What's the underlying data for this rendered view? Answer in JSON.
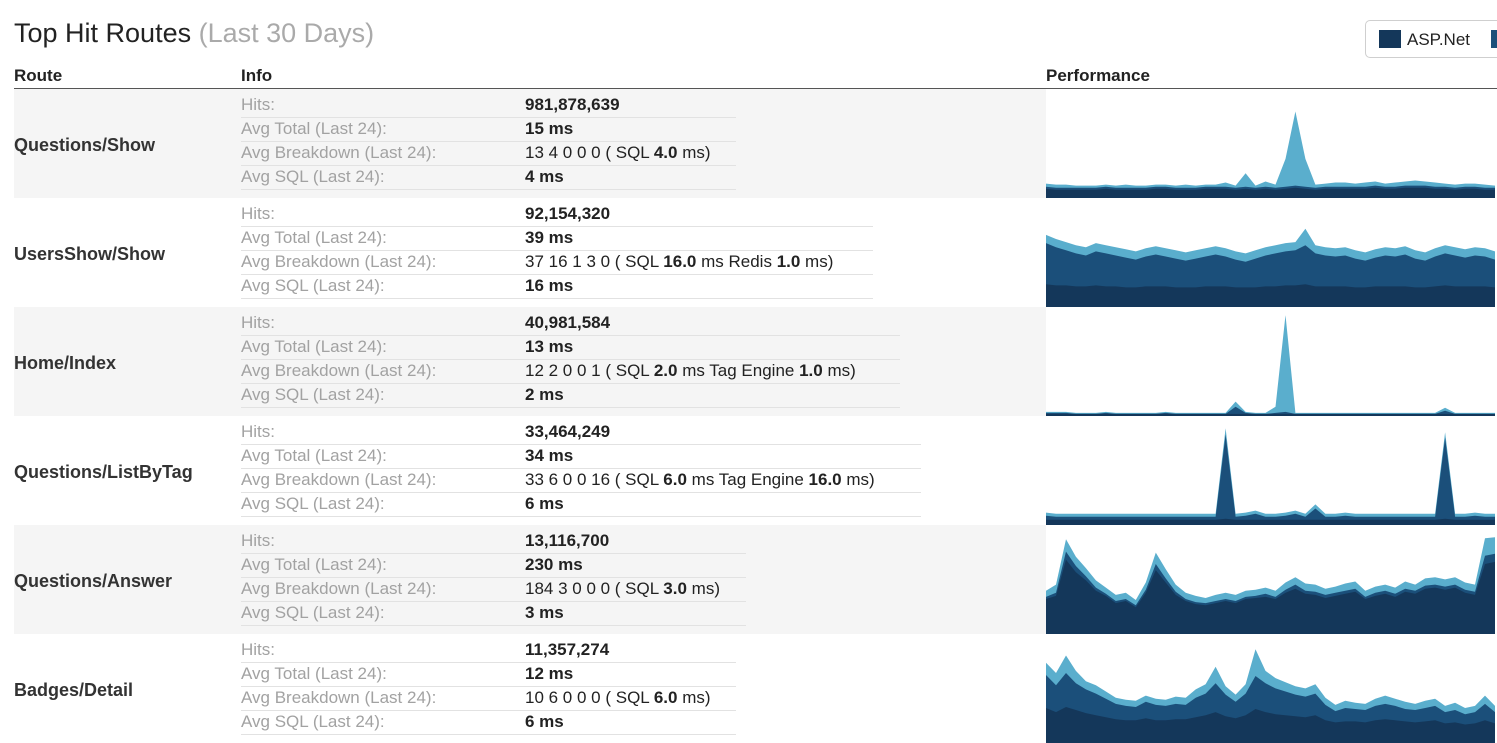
{
  "header": {
    "title": "Top Hit Routes",
    "subtitle": "(Last 30 Days)",
    "legend": "ASP.Net"
  },
  "columns": {
    "route": "Route",
    "info": "Info",
    "performance": "Performance"
  },
  "labels": {
    "hits": "Hits:",
    "avg_total": "Avg Total (Last 24):",
    "avg_breakdown": "Avg Breakdown (Last 24):",
    "avg_sql": "Avg SQL (Last 24):"
  },
  "colors": {
    "dark": "#14375a",
    "mid": "#1b4f7a",
    "light": "#5aaecd"
  },
  "rows": [
    {
      "route": "Questions/Show",
      "hits": "981,878,639",
      "avg_total": "15 ms",
      "breakdown": [
        {
          "t": "13 4 0 0 0 ( SQL "
        },
        {
          "t": "4.0",
          "b": true
        },
        {
          "t": " ms)"
        }
      ],
      "avg_sql": "4 ms",
      "perf": {
        "total": [
          14,
          13,
          13,
          12,
          12,
          12,
          13,
          12,
          13,
          12,
          12,
          13,
          13,
          12,
          13,
          12,
          13,
          13,
          15,
          12,
          24,
          12,
          16,
          13,
          38,
          84,
          38,
          13,
          14,
          15,
          15,
          14,
          15,
          16,
          14,
          15,
          16,
          17,
          16,
          15,
          14,
          13,
          14,
          14,
          13,
          12
        ],
        "mid": [
          11,
          10,
          10,
          10,
          10,
          10,
          11,
          10,
          10,
          10,
          10,
          11,
          11,
          10,
          10,
          10,
          11,
          11,
          11,
          10,
          11,
          10,
          11,
          10,
          11,
          12,
          11,
          10,
          11,
          11,
          11,
          11,
          11,
          12,
          11,
          11,
          12,
          12,
          12,
          11,
          11,
          10,
          11,
          11,
          10,
          10
        ],
        "dark": [
          9,
          8,
          8,
          8,
          8,
          8,
          9,
          8,
          8,
          8,
          8,
          9,
          9,
          8,
          8,
          8,
          9,
          9,
          9,
          8,
          9,
          8,
          9,
          8,
          9,
          10,
          9,
          8,
          9,
          9,
          9,
          9,
          9,
          10,
          9,
          9,
          10,
          10,
          10,
          9,
          9,
          8,
          9,
          9,
          8,
          8
        ]
      }
    },
    {
      "route": "UsersShow/Show",
      "hits": "92,154,320",
      "avg_total": "39 ms",
      "breakdown": [
        {
          "t": "37 16 1 3 0 ( SQL "
        },
        {
          "t": "16.0",
          "b": true
        },
        {
          "t": " ms Redis "
        },
        {
          "t": "1.0",
          "b": true
        },
        {
          "t": " ms)"
        }
      ],
      "avg_sql": "16 ms",
      "perf": {
        "total": [
          70,
          66,
          63,
          60,
          58,
          62,
          60,
          58,
          56,
          54,
          57,
          59,
          57,
          55,
          53,
          55,
          57,
          59,
          57,
          54,
          52,
          55,
          58,
          60,
          62,
          63,
          76,
          60,
          58,
          57,
          58,
          55,
          53,
          56,
          58,
          57,
          59,
          55,
          53,
          57,
          60,
          58,
          56,
          58,
          57,
          54
        ],
        "mid": [
          62,
          58,
          55,
          52,
          50,
          54,
          52,
          50,
          48,
          46,
          49,
          51,
          49,
          47,
          45,
          47,
          49,
          51,
          49,
          46,
          44,
          47,
          50,
          52,
          54,
          55,
          60,
          52,
          50,
          49,
          50,
          47,
          45,
          48,
          50,
          49,
          51,
          47,
          45,
          49,
          52,
          50,
          48,
          50,
          49,
          46
        ],
        "dark": [
          22,
          21,
          21,
          20,
          20,
          21,
          20,
          20,
          19,
          19,
          20,
          20,
          20,
          19,
          19,
          19,
          20,
          20,
          20,
          19,
          19,
          19,
          20,
          20,
          21,
          21,
          22,
          20,
          20,
          20,
          20,
          19,
          19,
          20,
          20,
          20,
          20,
          19,
          19,
          20,
          21,
          20,
          20,
          20,
          20,
          19
        ]
      }
    },
    {
      "route": "Home/Index",
      "hits": "40,981,584",
      "avg_total": "13 ms",
      "breakdown": [
        {
          "t": "12 2 0 0 1 ( SQL "
        },
        {
          "t": "2.0",
          "b": true
        },
        {
          "t": " ms Tag Engine "
        },
        {
          "t": "1.0",
          "b": true
        },
        {
          "t": " ms)"
        }
      ],
      "avg_sql": "2 ms",
      "perf": {
        "total": [
          4,
          4,
          4,
          3,
          3,
          3,
          4,
          3,
          3,
          3,
          3,
          3,
          4,
          3,
          3,
          3,
          3,
          3,
          3,
          14,
          4,
          3,
          3,
          9,
          98,
          3,
          3,
          3,
          3,
          3,
          3,
          3,
          3,
          3,
          3,
          3,
          3,
          3,
          3,
          3,
          8,
          3,
          3,
          3,
          3,
          3
        ],
        "mid": [
          3,
          3,
          3,
          2,
          2,
          2,
          3,
          2,
          2,
          2,
          2,
          2,
          3,
          2,
          2,
          2,
          2,
          2,
          2,
          9,
          3,
          2,
          2,
          3,
          4,
          2,
          2,
          2,
          2,
          2,
          2,
          2,
          2,
          2,
          2,
          2,
          2,
          2,
          2,
          2,
          5,
          2,
          2,
          2,
          2,
          2
        ],
        "dark": [
          2,
          2,
          2,
          2,
          2,
          2,
          2,
          2,
          2,
          2,
          2,
          2,
          2,
          2,
          2,
          2,
          2,
          2,
          2,
          2,
          2,
          2,
          2,
          2,
          2,
          2,
          2,
          2,
          2,
          2,
          2,
          2,
          2,
          2,
          2,
          2,
          2,
          2,
          2,
          2,
          2,
          2,
          2,
          2,
          2,
          2
        ]
      }
    },
    {
      "route": "Questions/ListByTag",
      "hits": "33,464,249",
      "avg_total": "34 ms",
      "breakdown": [
        {
          "t": "33 6 0 0 16 ( SQL "
        },
        {
          "t": "6.0",
          "b": true
        },
        {
          "t": " ms Tag Engine "
        },
        {
          "t": "16.0",
          "b": true
        },
        {
          "t": " ms)"
        }
      ],
      "avg_sql": "6 ms",
      "perf": {
        "total": [
          12,
          11,
          11,
          11,
          11,
          11,
          11,
          11,
          11,
          11,
          11,
          11,
          11,
          11,
          11,
          11,
          11,
          11,
          94,
          11,
          12,
          14,
          11,
          11,
          12,
          14,
          11,
          20,
          11,
          11,
          12,
          11,
          11,
          11,
          11,
          11,
          11,
          11,
          11,
          11,
          90,
          11,
          11,
          12,
          11,
          11
        ],
        "mid": [
          9,
          8,
          8,
          8,
          8,
          8,
          8,
          8,
          8,
          8,
          8,
          8,
          8,
          8,
          8,
          8,
          8,
          8,
          88,
          8,
          9,
          11,
          8,
          8,
          9,
          11,
          8,
          16,
          8,
          8,
          9,
          8,
          8,
          8,
          8,
          8,
          8,
          8,
          8,
          8,
          85,
          8,
          8,
          9,
          8,
          8
        ],
        "dark": [
          5,
          5,
          5,
          5,
          5,
          5,
          5,
          5,
          5,
          5,
          5,
          5,
          5,
          5,
          5,
          5,
          5,
          5,
          6,
          5,
          5,
          5,
          5,
          5,
          5,
          5,
          5,
          5,
          5,
          5,
          5,
          5,
          5,
          5,
          5,
          5,
          5,
          5,
          5,
          5,
          6,
          5,
          5,
          5,
          5,
          5
        ]
      }
    },
    {
      "route": "Questions/Answer",
      "hits": "13,116,700",
      "avg_total": "230 ms",
      "breakdown": [
        {
          "t": "184 3 0 0 0 ( SQL "
        },
        {
          "t": "3.0",
          "b": true
        },
        {
          "t": " ms)"
        }
      ],
      "avg_sql": "3 ms",
      "perf": {
        "total": [
          42,
          48,
          92,
          75,
          64,
          52,
          45,
          38,
          40,
          33,
          50,
          79,
          63,
          48,
          40,
          37,
          35,
          38,
          40,
          38,
          42,
          43,
          45,
          42,
          50,
          55,
          49,
          48,
          44,
          46,
          49,
          51,
          42,
          46,
          48,
          45,
          51,
          48,
          54,
          55,
          53,
          55,
          50,
          48,
          93,
          94
        ],
        "mid": [
          36,
          40,
          80,
          66,
          56,
          45,
          39,
          32,
          34,
          28,
          43,
          68,
          54,
          41,
          34,
          31,
          30,
          32,
          34,
          32,
          36,
          37,
          39,
          36,
          43,
          48,
          42,
          41,
          38,
          40,
          42,
          44,
          36,
          40,
          42,
          39,
          44,
          42,
          47,
          48,
          46,
          48,
          43,
          41,
          76,
          78
        ],
        "dark": [
          34,
          37,
          72,
          60,
          52,
          42,
          37,
          30,
          32,
          26,
          40,
          62,
          50,
          38,
          32,
          29,
          28,
          30,
          32,
          30,
          34,
          35,
          36,
          34,
          40,
          44,
          39,
          38,
          35,
          37,
          39,
          41,
          34,
          37,
          39,
          36,
          41,
          39,
          44,
          45,
          43,
          45,
          40,
          38,
          68,
          70
        ]
      }
    },
    {
      "route": "Badges/Detail",
      "hits": "11,357,274",
      "avg_total": "12 ms",
      "breakdown": [
        {
          "t": "10 6 0 0 0 ( SQL "
        },
        {
          "t": "6.0",
          "b": true
        },
        {
          "t": " ms)"
        }
      ],
      "avg_sql": "6 ms",
      "perf": {
        "total": [
          78,
          68,
          85,
          70,
          60,
          56,
          50,
          44,
          42,
          41,
          46,
          43,
          42,
          45,
          44,
          52,
          57,
          74,
          55,
          47,
          57,
          91,
          70,
          63,
          59,
          55,
          53,
          57,
          44,
          37,
          41,
          39,
          38,
          43,
          46,
          43,
          40,
          38,
          41,
          43,
          36,
          39,
          34,
          36,
          46,
          36
        ],
        "mid": [
          66,
          56,
          68,
          58,
          52,
          48,
          43,
          38,
          36,
          35,
          40,
          37,
          36,
          38,
          37,
          44,
          48,
          58,
          47,
          40,
          48,
          65,
          58,
          53,
          50,
          47,
          45,
          48,
          37,
          31,
          34,
          33,
          32,
          36,
          38,
          36,
          33,
          32,
          34,
          36,
          30,
          32,
          28,
          30,
          38,
          30
        ],
        "dark": [
          34,
          30,
          35,
          32,
          29,
          27,
          25,
          23,
          22,
          22,
          24,
          22,
          22,
          23,
          23,
          25,
          27,
          30,
          26,
          24,
          27,
          33,
          30,
          28,
          27,
          26,
          25,
          27,
          22,
          20,
          21,
          21,
          20,
          22,
          23,
          22,
          21,
          20,
          21,
          22,
          19,
          20,
          18,
          19,
          22,
          19
        ]
      }
    }
  ]
}
